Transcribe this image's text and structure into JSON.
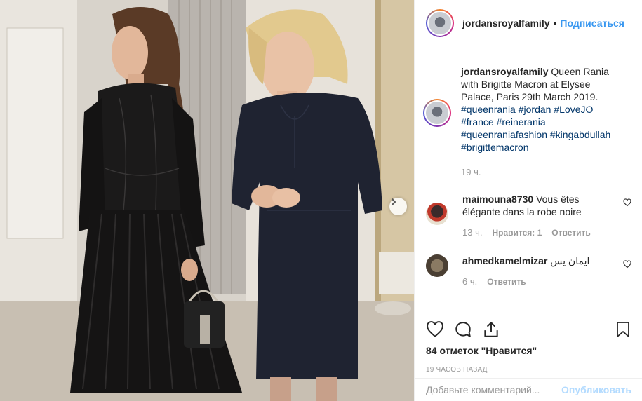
{
  "post": {
    "username": "jordansroyalfamily",
    "follow_label": "Подписаться",
    "separator": "•"
  },
  "caption": {
    "username": "jordansroyalfamily",
    "text": "Queen Rania with Brigitte Macron at Elysee Palace, Paris 29th March 2019.",
    "hashtags": [
      "#queenrania",
      "#jordan",
      "#LoveJO",
      "#france",
      "#reinerania",
      "#queenraniafashion",
      "#kingabdullah",
      "#brigittemacron"
    ],
    "time": "19 ч."
  },
  "comments": [
    {
      "username": "maimouna8730",
      "text": "Vous êtes élégante dans la robe noire",
      "time": "13 ч.",
      "likes_label": "Нравится: 1",
      "reply_label": "Ответить"
    },
    {
      "username": "ahmedkamelmizar",
      "text": "ايمان يس",
      "time": "6 ч.",
      "reply_label": "Ответить"
    }
  ],
  "footer": {
    "likes": "84 отметок \"Нравится\"",
    "timestamp": "19 ЧАСОВ НАЗАД",
    "comment_placeholder": "Добавьте комментарий...",
    "publish_label": "Опубликовать"
  },
  "icons": [
    "heart-icon",
    "comment-icon",
    "share-icon",
    "bookmark-icon",
    "chevron-right-icon"
  ],
  "colors": {
    "link": "#3897f0",
    "hashtag": "#003569",
    "muted": "#999999",
    "text": "#262626"
  }
}
